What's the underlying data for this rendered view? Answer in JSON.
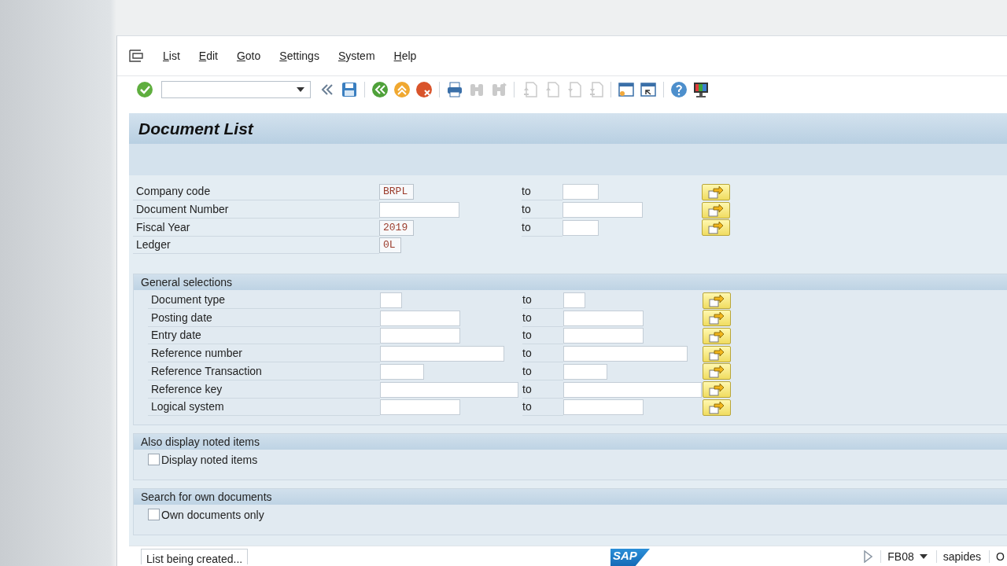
{
  "menu": [
    "List",
    "Edit",
    "Goto",
    "Settings",
    "System",
    "Help"
  ],
  "toolbar": [
    {
      "items": [
        {
          "kind": "enter",
          "disabled": false
        },
        {
          "kind": "command-field",
          "disabled": false
        },
        {
          "kind": "collapse",
          "disabled": false
        },
        {
          "kind": "save",
          "disabled": false
        }
      ]
    },
    {
      "items": [
        {
          "kind": "back",
          "disabled": false
        },
        {
          "kind": "exit",
          "disabled": false
        },
        {
          "kind": "cancel",
          "disabled": false
        }
      ]
    },
    {
      "items": [
        {
          "kind": "print",
          "disabled": false
        },
        {
          "kind": "find",
          "disabled": true
        },
        {
          "kind": "find-next",
          "disabled": true
        }
      ]
    },
    {
      "items": [
        {
          "kind": "first-page",
          "disabled": true
        },
        {
          "kind": "prev-page",
          "disabled": true
        },
        {
          "kind": "next-page",
          "disabled": true
        },
        {
          "kind": "last-page",
          "disabled": true
        }
      ]
    },
    {
      "items": [
        {
          "kind": "new-session",
          "disabled": false
        },
        {
          "kind": "shortcut",
          "disabled": false
        }
      ]
    },
    {
      "items": [
        {
          "kind": "help",
          "disabled": false
        },
        {
          "kind": "layout",
          "disabled": false
        }
      ]
    }
  ],
  "title": "Document List",
  "main_rows": [
    {
      "label": "Company code",
      "kind": "code",
      "value": "BRPL",
      "to": "to"
    },
    {
      "label": "Document Number",
      "kind": "number",
      "to": "to"
    },
    {
      "label": "Fiscal Year",
      "kind": "code",
      "value": "2019",
      "to": "to"
    },
    {
      "label": "Ledger",
      "kind": "short",
      "value": "0L"
    }
  ],
  "sections": [
    {
      "title": "General selections",
      "kind": "fields",
      "rows": [
        {
          "label": "Document type",
          "kind": "short",
          "to": "to"
        },
        {
          "label": "Posting date",
          "kind": "number",
          "to": "to"
        },
        {
          "label": "Entry date",
          "kind": "number",
          "to": "to"
        },
        {
          "label": "Reference number",
          "kind": "long",
          "to": "to"
        },
        {
          "label": "Reference Transaction",
          "kind": "medium",
          "to": "to"
        },
        {
          "label": "Reference key",
          "kind": "wide",
          "to": "to"
        },
        {
          "label": "Logical system",
          "kind": "number",
          "to": "to"
        }
      ]
    },
    {
      "title": "Also display noted items",
      "kind": "checkbox",
      "label": "Display noted items",
      "checked": false
    },
    {
      "title": "Search for own documents",
      "kind": "checkbox",
      "label": "Own documents only",
      "checked": false
    }
  ],
  "status_bar": {
    "message": "List being created...",
    "logo": "SAP",
    "transaction": "FB08",
    "system": "sapides",
    "mode": "O"
  }
}
